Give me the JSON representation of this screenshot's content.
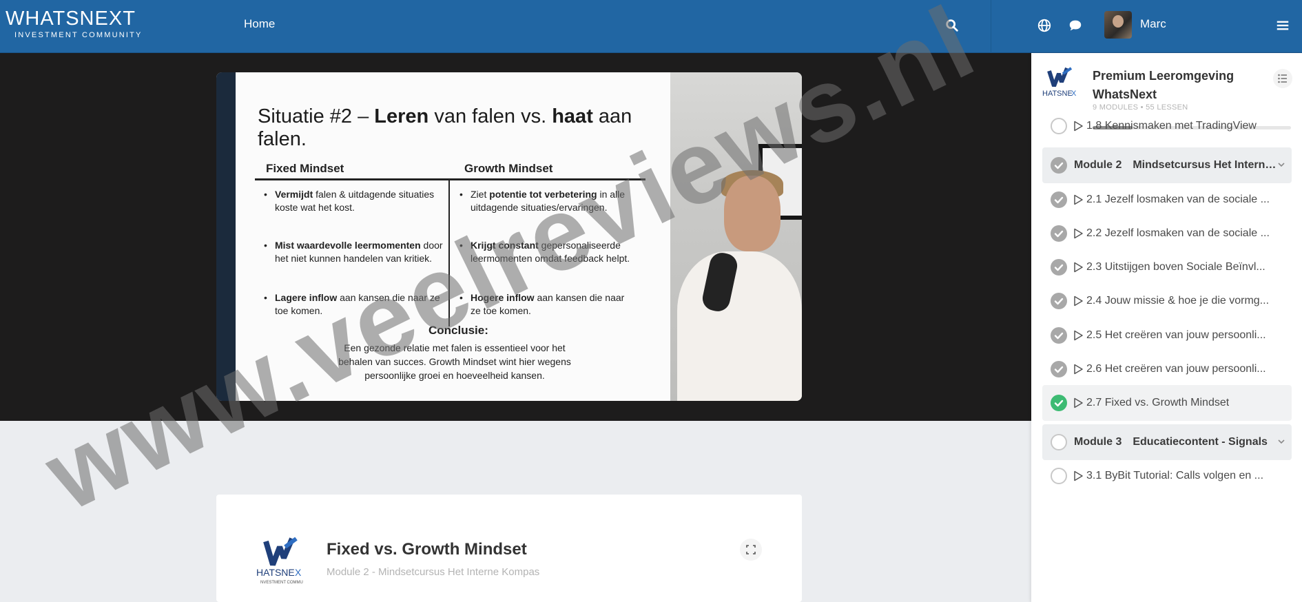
{
  "header": {
    "logo_text": "WHATSNEXT",
    "logo_subtitle": "INVESTMENT COMMUNITY",
    "nav_home": "Home",
    "user_name": "Marc"
  },
  "video": {
    "slide": {
      "title_prefix": "Situatie #2 – ",
      "title_b1": "Leren",
      "title_mid": " van falen vs. ",
      "title_b2": "haat",
      "title_suffix": " aan falen.",
      "left_heading": "Fixed Mindset",
      "right_heading": "Growth Mindset",
      "left_bullets": [
        {
          "bold": "Vermijdt",
          "text": " falen & uitdagende situaties koste wat het kost."
        },
        {
          "bold": "Mist waardevolle leermomenten",
          "text": " door het niet kunnen handelen van kritiek."
        },
        {
          "bold": "Lagere inflow",
          "text": " aan kansen die naar ze toe komen."
        }
      ],
      "right_bullets": [
        {
          "pre": "Ziet ",
          "bold": "potentie tot verbetering",
          "text": " in alle uitdagende situaties/ervaringen."
        },
        {
          "pre": "",
          "bold": "Krijgt constant",
          "text": " gepersonaliseerde leermomenten omdat feedback helpt."
        },
        {
          "pre": "",
          "bold": "Hogere inflow",
          "text": " aan kansen die naar ze toe komen."
        }
      ],
      "conclusion_title": "Conclusie:",
      "conclusion_text": "Een gezonde relatie met falen is essentieel voor het behalen van succes. Growth Mindset wint hier wegens persoonlijke groei en hoeveelheid kansen."
    }
  },
  "lesson_card": {
    "title": "Fixed vs. Growth Mindset",
    "subtitle": "Module 2 - Mindsetcursus Het Interne Kompas"
  },
  "sidebar": {
    "course_title": "Premium Leeromgeving WhatsNext",
    "meta": "9 MODULES  •  55 LESSEN",
    "progress": 0.2,
    "items": [
      {
        "type": "lesson",
        "status": "empty",
        "label": "1.8 Kennismaken met TradingView"
      },
      {
        "type": "module",
        "status": "done",
        "label": "Module 2",
        "name": "Mindsetcursus Het Interne Kompas"
      },
      {
        "type": "lesson",
        "status": "done",
        "label": "2.1 Jezelf losmaken van de sociale ..."
      },
      {
        "type": "lesson",
        "status": "done",
        "label": "2.2 Jezelf losmaken van de sociale ..."
      },
      {
        "type": "lesson",
        "status": "done",
        "label": "2.3 Uitstijgen boven Sociale Beïnvl..."
      },
      {
        "type": "lesson",
        "status": "done",
        "label": "2.4 Jouw missie & hoe je die vormg..."
      },
      {
        "type": "lesson",
        "status": "done",
        "label": "2.5 Het creëren van jouw persoonli..."
      },
      {
        "type": "lesson",
        "status": "done",
        "label": "2.6 Het creëren van jouw persoonli..."
      },
      {
        "type": "lesson",
        "status": "green",
        "label": "2.7 Fixed vs. Growth Mindset"
      },
      {
        "type": "module",
        "status": "empty",
        "label": "Module 3",
        "name": "Educatiecontent - Signals"
      },
      {
        "type": "lesson",
        "status": "empty",
        "label": "3.1 ByBit Tutorial: Calls volgen en ..."
      }
    ]
  },
  "watermark": "www.veelreviews.nl",
  "colors": {
    "topbar": "#2166a3",
    "check_done": "#a8a8a8",
    "check_current": "#3dbb73"
  }
}
